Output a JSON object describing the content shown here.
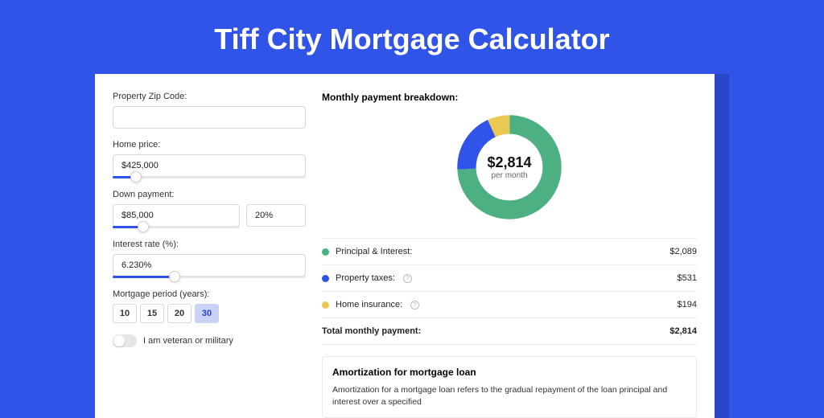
{
  "title": "Tiff City Mortgage Calculator",
  "form": {
    "zip_label": "Property Zip Code:",
    "zip_value": "",
    "price_label": "Home price:",
    "price_value": "$425,000",
    "down_label": "Down payment:",
    "down_value": "$85,000",
    "down_pct": "20%",
    "rate_label": "Interest rate (%):",
    "rate_value": "6.230%",
    "period_label": "Mortgage period (years):",
    "periods": [
      "10",
      "15",
      "20",
      "30"
    ],
    "period_selected": "30",
    "veteran_label": "I am veteran or military"
  },
  "breakdown": {
    "title": "Monthly payment breakdown:",
    "center_amount": "$2,814",
    "center_sub": "per month",
    "rows": [
      {
        "label": "Principal & Interest:",
        "value": "$2,089",
        "color": "#4db083",
        "info": false
      },
      {
        "label": "Property taxes:",
        "value": "$531",
        "color": "#3053e8",
        "info": true
      },
      {
        "label": "Home insurance:",
        "value": "$194",
        "color": "#e9c952",
        "info": true
      }
    ],
    "total_label": "Total monthly payment:",
    "total_value": "$2,814"
  },
  "amort": {
    "title": "Amortization for mortgage loan",
    "text": "Amortization for a mortgage loan refers to the gradual repayment of the loan principal and interest over a specified"
  },
  "chart_data": {
    "type": "pie",
    "title": "Monthly payment breakdown",
    "series": [
      {
        "name": "Principal & Interest",
        "value": 2089,
        "color": "#4db083"
      },
      {
        "name": "Property taxes",
        "value": 531,
        "color": "#3053e8"
      },
      {
        "name": "Home insurance",
        "value": 194,
        "color": "#e9c952"
      }
    ],
    "total": 2814,
    "center_label": "$2,814 per month"
  }
}
